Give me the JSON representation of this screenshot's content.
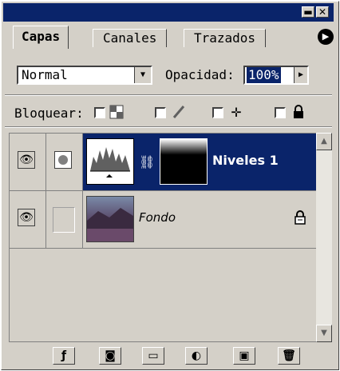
{
  "window": {
    "minimize_label": "▬",
    "close_label": "✕"
  },
  "tabs": [
    {
      "label": "Capas",
      "active": true
    },
    {
      "label": "Canales",
      "active": false
    },
    {
      "label": "Trazados",
      "active": false
    }
  ],
  "blend": {
    "mode": "Normal",
    "opacity_label": "Opacidad:",
    "opacity_value": "100%"
  },
  "lock": {
    "label": "Bloquear:"
  },
  "layers": [
    {
      "name": "Niveles 1",
      "selected": true,
      "type": "adjustment"
    },
    {
      "name": "Fondo",
      "selected": false,
      "type": "image"
    }
  ],
  "icons": {
    "panel_menu": "menu-arrow-icon",
    "eye": "eye-icon",
    "lock": "lock-icon"
  },
  "colors": {
    "selection": "#0a246a",
    "panel": "#d4d0c8"
  }
}
